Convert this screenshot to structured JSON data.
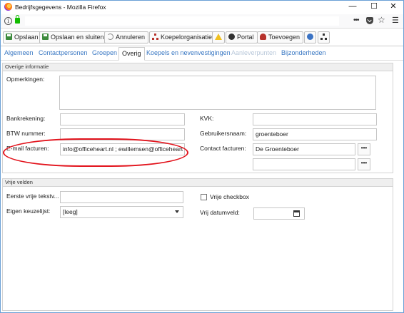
{
  "window": {
    "title": "Bedrijfsgegevens - Mozilla Firefox",
    "controls": {
      "minimize": "—",
      "maximize": "☐",
      "close": "✕"
    }
  },
  "addressbar": {
    "url": "",
    "more": "•••",
    "star": "☆",
    "menu": "☰",
    "info": "i"
  },
  "toolbar": {
    "save_label": "Opslaan",
    "save_close_label": "Opslaan en sluiten",
    "cancel_label": "Annuleren",
    "parent_org_label": "Koepelorganisatie",
    "portal_label": "Portal",
    "add_label": "Toevoegen"
  },
  "tabs": [
    {
      "label": "Algemeen",
      "state": "normal"
    },
    {
      "label": "Contactpersonen",
      "state": "normal"
    },
    {
      "label": "Groepen",
      "state": "normal"
    },
    {
      "label": "Overig",
      "state": "active"
    },
    {
      "label": "Koepels en nevenvestigingen",
      "state": "normal"
    },
    {
      "label": "Aanleverpunten",
      "state": "disabled"
    },
    {
      "label": "Bijzonderheden",
      "state": "normal"
    }
  ],
  "other_info": {
    "header": "Overige informatie",
    "remarks_label": "Opmerkingen:",
    "remarks_value": "",
    "bank_label": "Bankrekening:",
    "bank_value": "",
    "vat_label": "BTW nummer:",
    "vat_value": "",
    "invoice_email_label": "E-mail facturen:",
    "invoice_email_value": "info@officeheart.nl ; ewillemsen@officeheart",
    "kvk_label": "KVK:",
    "kvk_value": "",
    "username_label": "Gebruikersnaam:",
    "username_value": "groenteboer",
    "invoice_contact_label": "Contact facturen:",
    "invoice_contact_value": "De Groenteboer",
    "invoice_contact_value2": "",
    "ellipsis": "•••"
  },
  "free_fields": {
    "header": "Vrije velden",
    "first_text_label": "Eerste vrije tekstv...",
    "first_text_value": "",
    "custom_list_label": "Eigen keuzelijst:",
    "custom_list_value": "[leeg]",
    "checkbox_label": "Vrije checkbox",
    "checkbox_checked": false,
    "date_label": "Vrij datumveld:",
    "date_value": ""
  },
  "colors": {
    "accent": "#3a78c3",
    "highlight": "#e2131c",
    "disabled_tab": "#b9c8da"
  }
}
